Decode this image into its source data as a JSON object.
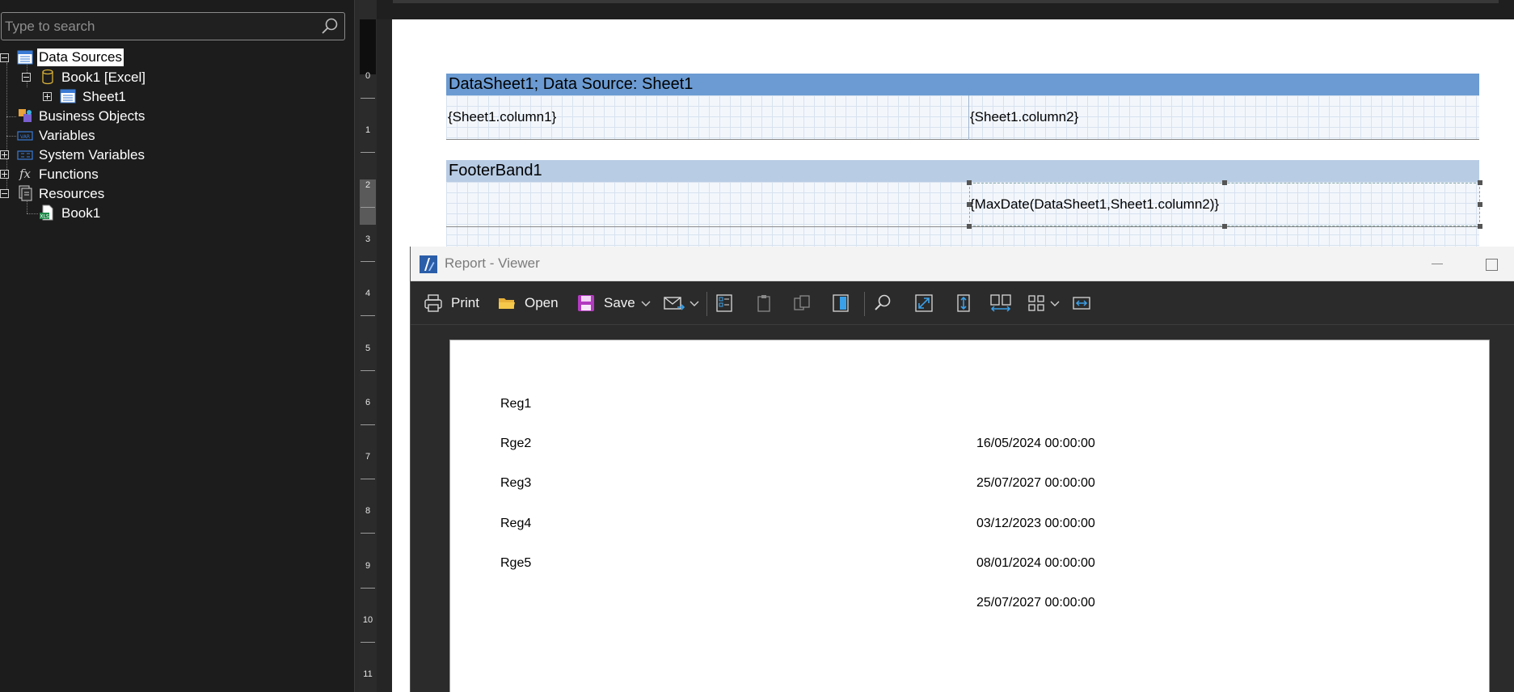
{
  "search": {
    "placeholder": "Type to search"
  },
  "tree": {
    "data_sources": "Data Sources",
    "book1_excel": "Book1 [Excel]",
    "sheet1": "Sheet1",
    "business_objects": "Business Objects",
    "variables": "Variables",
    "system_variables": "System Variables",
    "functions": "Functions",
    "resources": "Resources",
    "book1": "Book1"
  },
  "ruler": {
    "labels": [
      "0",
      "1",
      "2",
      "3",
      "4",
      "5",
      "6",
      "7",
      "8",
      "9",
      "10",
      "11"
    ]
  },
  "design": {
    "databand_header": "DataSheet1; Data Source: Sheet1",
    "field1": "{Sheet1.column1}",
    "field2": "{Sheet1.column2}",
    "footer_header": "FooterBand1",
    "footer_field": "{MaxDate(DataSheet1,Sheet1.column2)}"
  },
  "viewer": {
    "title": "Report - Viewer",
    "toolbar": {
      "print": "Print",
      "open": "Open",
      "save": "Save"
    },
    "rows": [
      {
        "c1": "Reg1",
        "c2": ""
      },
      {
        "c1": "Rge2",
        "c2": "16/05/2024 00:00:00"
      },
      {
        "c1": "Reg3",
        "c2": "25/07/2027 00:00:00"
      },
      {
        "c1": "Reg4",
        "c2": "03/12/2023 00:00:00"
      },
      {
        "c1": "Rge5",
        "c2": "08/01/2024 00:00:00"
      }
    ],
    "footer_value": "25/07/2027 00:00:00"
  },
  "colors": {
    "databand_header_bg": "#6b9bd2",
    "footer_header_bg": "#b8cce4",
    "panel_bg": "#1c1c1c",
    "toolbar_bg": "#2b2b2b"
  }
}
